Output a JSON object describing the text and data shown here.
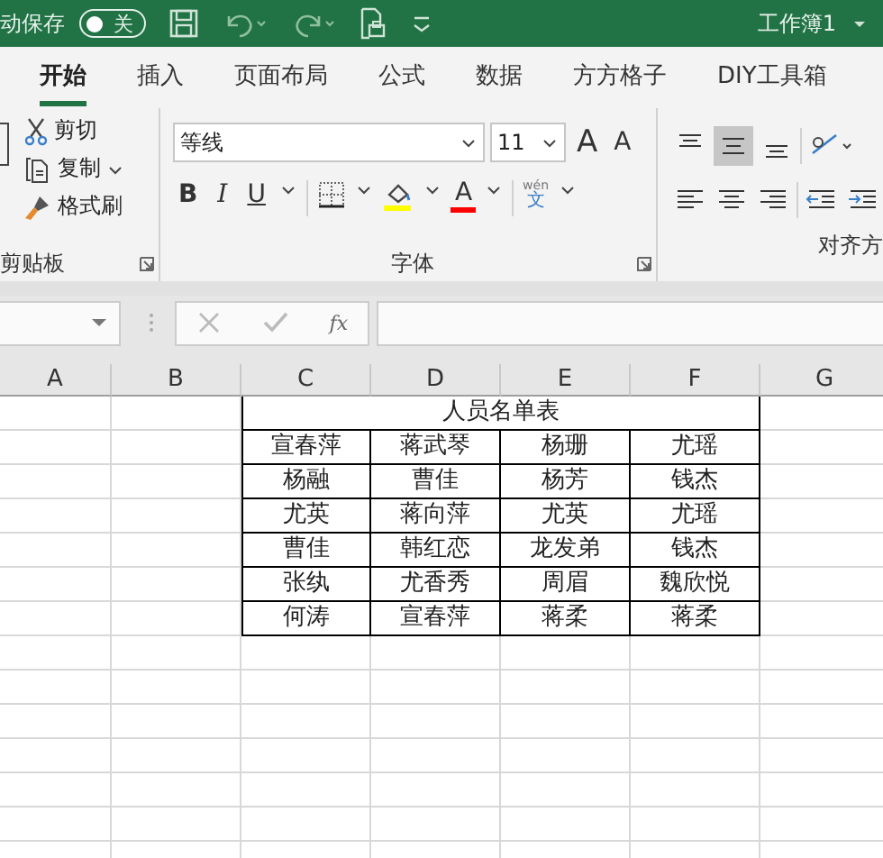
{
  "title_bar": {
    "autosave_label": "动保存",
    "autosave_toggle": {
      "label": "关",
      "on": false
    },
    "workbook": "工作簿1"
  },
  "tabs": [
    {
      "label": "开始",
      "selected": true
    },
    {
      "label": "插入",
      "selected": false
    },
    {
      "label": "页面布局",
      "selected": false
    },
    {
      "label": "公式",
      "selected": false
    },
    {
      "label": "数据",
      "selected": false
    },
    {
      "label": "方方格子",
      "selected": false
    },
    {
      "label": "DIY工具箱",
      "selected": false
    }
  ],
  "clipboard": {
    "cut": "剪切",
    "copy": "复制",
    "format_painter": "格式刷",
    "label": "剪贴板"
  },
  "font": {
    "name": "等线",
    "size": "11",
    "grow": "A",
    "shrink": "A",
    "bold": "B",
    "italic": "I",
    "underline": "U",
    "font_color": "A",
    "phonetic_top": "wén",
    "phonetic_bottom": "文",
    "label": "字体"
  },
  "alignment": {
    "label": "对齐方"
  },
  "formula_bar": {
    "fx": "fx"
  },
  "columns": [
    "A",
    "B",
    "C",
    "D",
    "E",
    "F",
    "G"
  ],
  "table": {
    "title": "人员名单表",
    "rows": [
      [
        "宣春萍",
        "蒋武琴",
        "杨珊",
        "尤瑶"
      ],
      [
        "杨融",
        "曹佳",
        "杨芳",
        "钱杰"
      ],
      [
        "尤英",
        "蒋向萍",
        "尤英",
        "尤瑶"
      ],
      [
        "曹佳",
        "韩红恋",
        "龙发弟",
        "钱杰"
      ],
      [
        "张纨",
        "尤香秀",
        "周眉",
        "魏欣悦"
      ],
      [
        "何涛",
        "宣春萍",
        "蒋柔",
        "蒋柔"
      ]
    ]
  }
}
